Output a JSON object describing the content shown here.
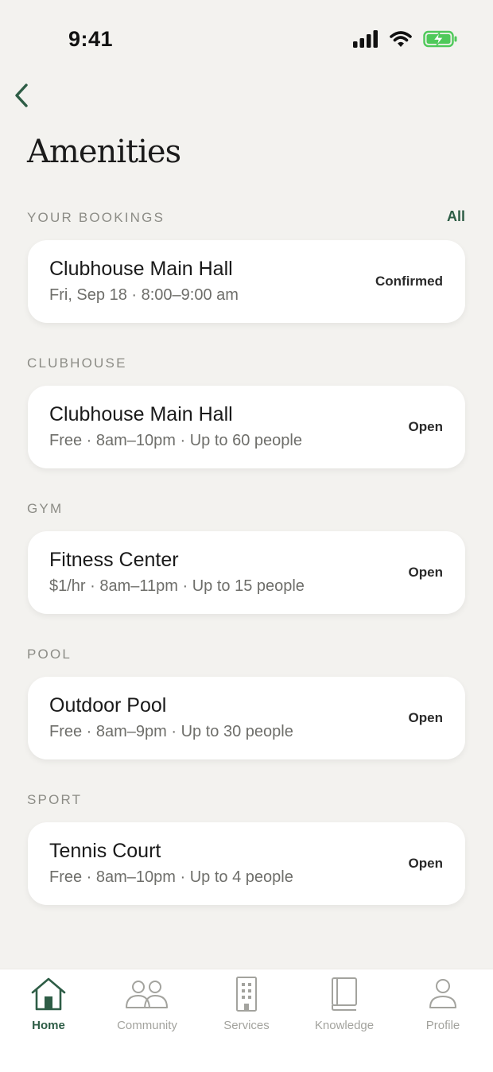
{
  "status_bar": {
    "time": "9:41"
  },
  "header": {
    "back_icon": "chevron-left-icon",
    "title": "Amenities"
  },
  "bookings": {
    "label": "YOUR BOOKINGS",
    "all_link": "All",
    "items": [
      {
        "title": "Clubhouse Main Hall",
        "subtitle": "Fri, Sep 18 · 8:00–9:00 am",
        "status": "Confirmed"
      }
    ]
  },
  "sections": [
    {
      "label": "CLUBHOUSE",
      "item": {
        "title": "Clubhouse Main Hall",
        "subtitle": "Free · 8am–10pm · Up to 60 people",
        "status": "Open"
      }
    },
    {
      "label": "GYM",
      "item": {
        "title": "Fitness Center",
        "subtitle": "$1/hr · 8am–11pm · Up to 15 people",
        "status": "Open"
      }
    },
    {
      "label": "POOL",
      "item": {
        "title": "Outdoor Pool",
        "subtitle": "Free · 8am–9pm · Up to 30 people",
        "status": "Open"
      }
    },
    {
      "label": "SPORT",
      "item": {
        "title": "Tennis Court",
        "subtitle": "Free · 8am–10pm · Up to 4 people",
        "status": "Open"
      }
    }
  ],
  "tab_bar": {
    "tabs": [
      {
        "label": "Home",
        "icon": "home-icon",
        "active": true
      },
      {
        "label": "Community",
        "icon": "people-icon",
        "active": false
      },
      {
        "label": "Services",
        "icon": "building-icon",
        "active": false
      },
      {
        "label": "Knowledge",
        "icon": "book-icon",
        "active": false
      },
      {
        "label": "Profile",
        "icon": "person-icon",
        "active": false
      }
    ]
  },
  "colors": {
    "accent": "#2e5d46",
    "background": "#f3f2ef",
    "battery": "#4fc95a"
  }
}
